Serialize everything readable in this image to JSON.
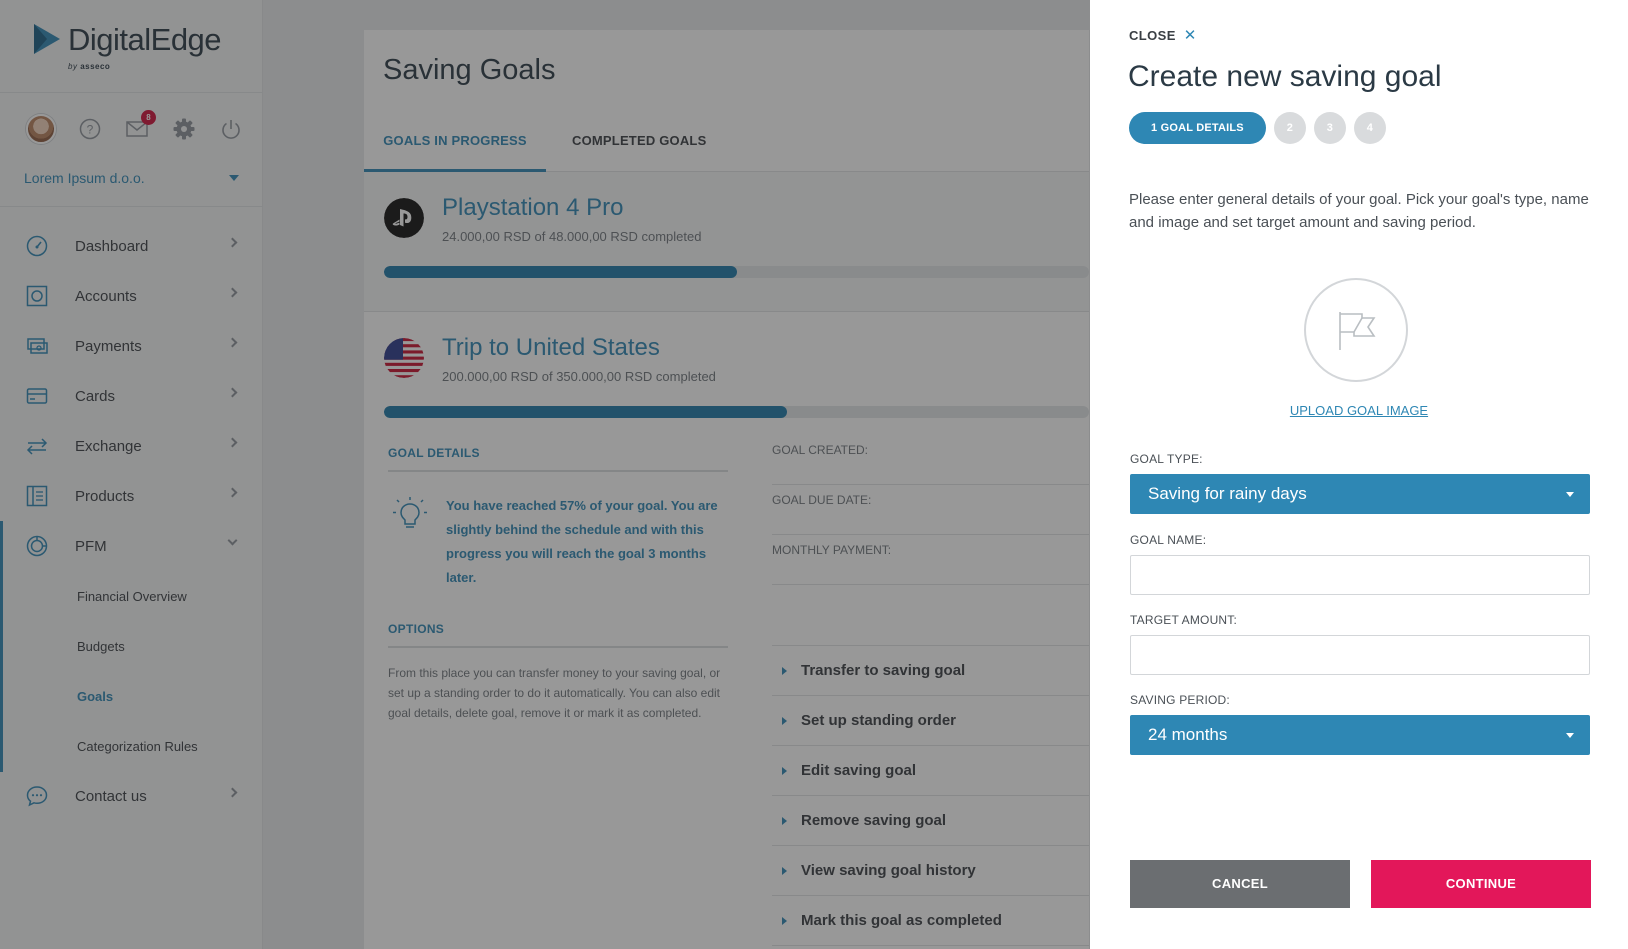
{
  "brand": {
    "name": "DigitalEdge",
    "sub_prefix": "by",
    "sub_name": "asseco"
  },
  "header": {
    "notifications_count": "8"
  },
  "company": {
    "name": "Lorem Ipsum d.o.o."
  },
  "sidebar": {
    "items": [
      {
        "label": "Dashboard",
        "icon": "dashboard-icon"
      },
      {
        "label": "Accounts",
        "icon": "accounts-icon"
      },
      {
        "label": "Payments",
        "icon": "payments-icon"
      },
      {
        "label": "Cards",
        "icon": "cards-icon"
      },
      {
        "label": "Exchange",
        "icon": "exchange-icon"
      },
      {
        "label": "Products",
        "icon": "products-icon"
      },
      {
        "label": "PFM",
        "icon": "pfm-icon"
      }
    ],
    "pfm_sub": [
      {
        "label": "Financial Overview"
      },
      {
        "label": "Budgets"
      },
      {
        "label": "Goals"
      },
      {
        "label": "Categorization Rules"
      }
    ],
    "contact": {
      "label": "Contact us",
      "icon": "chat-icon"
    }
  },
  "main": {
    "title": "Saving Goals",
    "tabs": [
      {
        "label": "GOALS IN PROGRESS"
      },
      {
        "label": "COMPLETED GOALS"
      }
    ],
    "goals": [
      {
        "name": "Playstation 4 Pro",
        "progress_text": "24.000,00 RSD of 48.000,00 RSD completed",
        "progress_fraction": 0.5
      },
      {
        "name": "Trip to United States",
        "progress_text": "200.000,00 RSD of 350.000,00 RSD completed",
        "progress_fraction": 0.571
      }
    ],
    "details": {
      "title": "GOAL DETAILS",
      "tip": "You have reached 57% of your goal. You are slightly behind the schedule and with this progress you will reach the goal 3 months later."
    },
    "kv": [
      {
        "label": "GOAL CREATED:"
      },
      {
        "label": "GOAL DUE DATE:"
      },
      {
        "label": "MONTHLY PAYMENT:"
      }
    ],
    "options": {
      "title": "OPTIONS",
      "text": "From this place you can transfer money to your saving goal, or set up a standing order to do it automatically. You can also edit goal details, delete goal, remove it or mark it as completed."
    },
    "actions": [
      {
        "label": "Transfer to saving goal"
      },
      {
        "label": "Set up standing order"
      },
      {
        "label": "Edit saving goal"
      },
      {
        "label": "Remove saving goal"
      },
      {
        "label": "View saving goal history"
      },
      {
        "label": "Mark this goal as completed"
      }
    ]
  },
  "panel": {
    "close_label": "CLOSE",
    "title": "Create new saving goal",
    "steps": {
      "active": "1 GOAL DETAILS",
      "others": [
        "2",
        "3",
        "4"
      ]
    },
    "intro": "Please enter general details of your goal. Pick your goal's type, name and image and set target amount and saving period.",
    "upload_label": "UPLOAD GOAL IMAGE",
    "goal_type": {
      "label": "GOAL TYPE:",
      "value": "Saving for rainy days"
    },
    "goal_name": {
      "label": "GOAL NAME:",
      "value": ""
    },
    "target_amount": {
      "label": "TARGET AMOUNT:",
      "value": ""
    },
    "saving_period": {
      "label": "SAVING PERIOD:",
      "value": "24 months"
    },
    "cancel_label": "CANCEL",
    "continue_label": "CONTINUE"
  },
  "colors": {
    "accent": "#2e87b4",
    "primary_button": "#e3175a",
    "secondary_button": "#6b6e71",
    "badge": "#d0103a"
  }
}
